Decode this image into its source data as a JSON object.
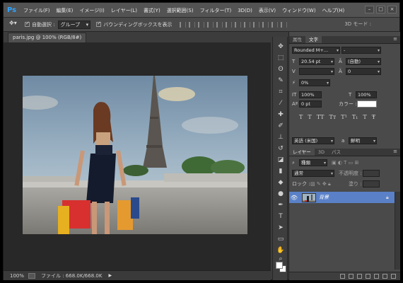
{
  "app": {
    "logo": "Ps"
  },
  "menu": [
    "ファイル(F)",
    "編集(E)",
    "イメージ(I)",
    "レイヤー(L)",
    "書式(Y)",
    "選択範囲(S)",
    "フィルター(T)",
    "3D(D)",
    "表示(V)",
    "ウィンドウ(W)",
    "ヘルプ(H)"
  ],
  "window_controls": [
    "–",
    "□",
    "×"
  ],
  "options": {
    "tool_icon": "move-tool-icon",
    "auto_select_label": "自動選択 :",
    "auto_select_value": "グループ",
    "bounding_box_label": "バウンディングボックスを表示",
    "mode_3d_label": "3D モード :"
  },
  "document": {
    "tab_title": "paris.jpg @ 100% (RGB/8#)"
  },
  "status": {
    "zoom": "100%",
    "file_info": "ファイル : 668.0K/668.0K"
  },
  "toolbar_icons": [
    "move-tool-icon",
    "marquee-tool-icon",
    "lasso-tool-icon",
    "quick-select-tool-icon",
    "crop-tool-icon",
    "eyedropper-tool-icon",
    "healing-brush-tool-icon",
    "brush-tool-icon",
    "clone-stamp-tool-icon",
    "history-brush-tool-icon",
    "eraser-tool-icon",
    "gradient-tool-icon",
    "blur-tool-icon",
    "dodge-tool-icon",
    "pen-tool-icon",
    "type-tool-icon",
    "path-select-tool-icon",
    "shape-tool-icon",
    "hand-tool-icon",
    "zoom-tool-icon"
  ],
  "char_panel": {
    "tabs": [
      "属性",
      "文字"
    ],
    "font_family": "Rounded M+...",
    "font_style": "-",
    "font_size": "20.54 pt",
    "leading": "(自動)",
    "kerning": "",
    "tracking": "0",
    "tsume": "0%",
    "vertical_scale": "100%",
    "horizontal_scale": "100%",
    "baseline_shift": "0 pt",
    "color_label": "カラー :",
    "color_value": "#ffffff",
    "language": "英語 (米国)",
    "antialias_prefix": "a",
    "antialias": "鮮明"
  },
  "layers_panel": {
    "tabs": [
      "レイヤー",
      "3D",
      "パス"
    ],
    "filter_label": "種類",
    "blend_mode": "通常",
    "opacity_label": "不透明度 :",
    "lock_label": "ロック :",
    "fill_label": "塗り :",
    "layer_name": "背景"
  }
}
